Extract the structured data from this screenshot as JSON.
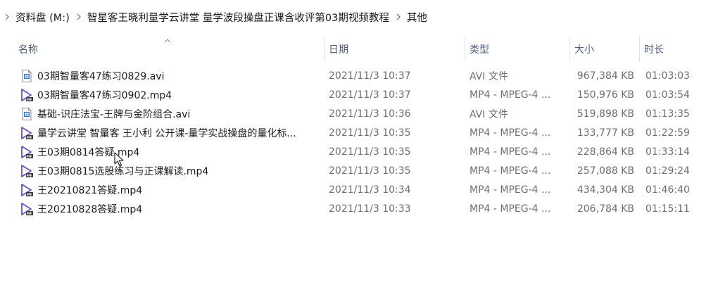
{
  "breadcrumb": [
    {
      "label": "资料盘 (M:)"
    },
    {
      "label": "智星客王晓利量学云讲堂 量学波段操盘正课含收评第03期视频教程"
    },
    {
      "label": "其他"
    }
  ],
  "columns": {
    "name": "名称",
    "date": "日期",
    "type": "类型",
    "size": "大小",
    "duration": "时长"
  },
  "files": [
    {
      "name": "03期智量客47练习0829.avi",
      "date": "2021/11/3 10:37",
      "type": "AVI 文件",
      "size": "967,384 KB",
      "duration": "01:03:03",
      "icon": "avi-file-icon"
    },
    {
      "name": "03期智量客47练习0902.mp4",
      "date": "2021/11/3 10:37",
      "type": "MP4 - MPEG-4 ...",
      "size": "150,976 KB",
      "duration": "01:03:54",
      "icon": "mp4-file-icon"
    },
    {
      "name": "基础-识庄法宝-王牌与金阶组合.avi",
      "date": "2021/11/3 10:36",
      "type": "AVI 文件",
      "size": "519,898 KB",
      "duration": "01:13:35",
      "icon": "avi-file-icon"
    },
    {
      "name": "量学云讲堂 智量客 王小利 公开课-量学实战操盘的量化标...",
      "date": "2021/11/3 10:35",
      "type": "MP4 - MPEG-4 ...",
      "size": "133,777 KB",
      "duration": "01:22:59",
      "icon": "mp4-file-icon"
    },
    {
      "name": "王03期0814答疑.mp4",
      "date": "2021/11/3 10:35",
      "type": "MP4 - MPEG-4 ...",
      "size": "228,864 KB",
      "duration": "01:33:14",
      "icon": "mp4-file-icon"
    },
    {
      "name": "王03期0815选股练习与正课解读.mp4",
      "date": "2021/11/3 10:35",
      "type": "MP4 - MPEG-4 ...",
      "size": "257,088 KB",
      "duration": "01:29:24",
      "icon": "mp4-file-icon"
    },
    {
      "name": "王20210821答疑.mp4",
      "date": "2021/11/3 10:34",
      "type": "MP4 - MPEG-4 ...",
      "size": "434,304 KB",
      "duration": "01:46:40",
      "icon": "mp4-file-icon"
    },
    {
      "name": "王20210828答疑.mp4",
      "date": "2021/11/3 10:33",
      "type": "MP4 - MPEG-4 ...",
      "size": "206,784 KB",
      "duration": "01:15:11",
      "icon": "mp4-file-icon"
    }
  ],
  "colors": {
    "header_text": "#4c607a",
    "secondary_text": "#6d6d6d",
    "play_icon": "#6b4fbb",
    "avi_icon": "#2b7cd3"
  }
}
